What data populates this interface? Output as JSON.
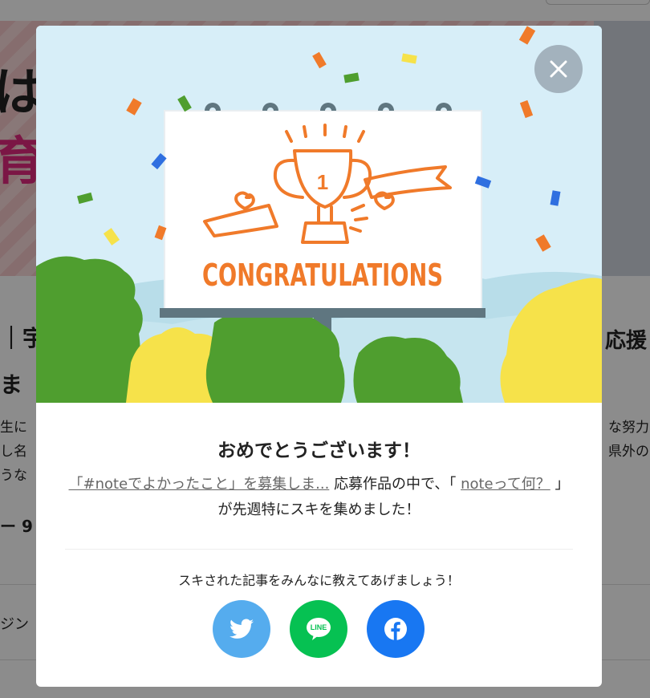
{
  "background": {
    "hero_chars": [
      "は",
      "育"
    ],
    "heading_fragments": [
      "｜宇",
      "ま",
      "応援"
    ],
    "excerpt_fragments": [
      "生に",
      "し名",
      "うな",
      "な努力",
      "県外の"
    ],
    "meta_fragment": "ー 9",
    "magazine_fragment": "ジン"
  },
  "modal": {
    "close_icon": "close-icon",
    "illustration": {
      "banner_text": "CONGRATULATIONS",
      "trophy_number": "1"
    },
    "title": "おめでとうございます！",
    "contest_link": "「#noteでよかったこと」を募集しま...",
    "text_middle": "応募作品の中で、「",
    "article_link": "noteって何？",
    "text_end": "」が先週特にスキを集めました！",
    "share_label": "スキされた記事をみんなに教えてあげましょう！",
    "share_buttons": [
      {
        "name": "twitter",
        "icon": "twitter-icon",
        "color": "#55acee"
      },
      {
        "name": "line",
        "icon": "line-icon",
        "label": "LINE",
        "color": "#06c152"
      },
      {
        "name": "facebook",
        "icon": "facebook-icon",
        "color": "#1877f2"
      }
    ]
  }
}
